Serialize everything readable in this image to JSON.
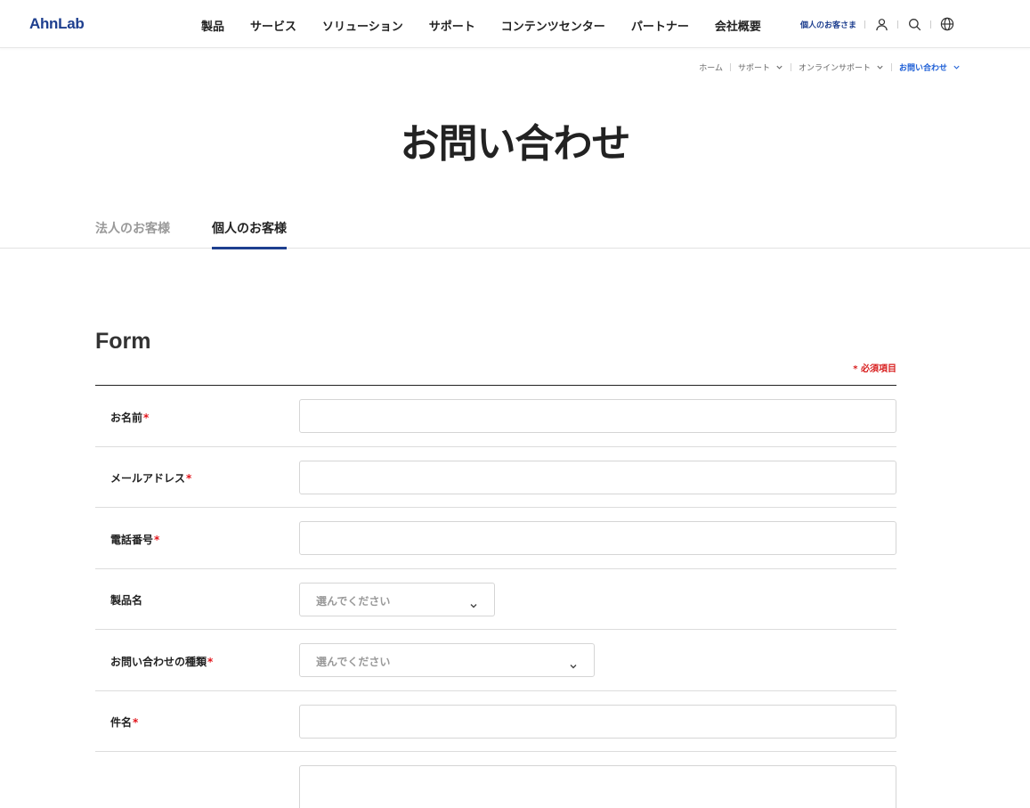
{
  "header": {
    "logo": "AhnLab",
    "nav": [
      "製品",
      "サービス",
      "ソリューション",
      "サポート",
      "コンテンツセンター",
      "パートナー",
      "会社概要"
    ],
    "util_link": "個人のお客さま",
    "icons": [
      "user-icon",
      "search-icon",
      "globe-icon"
    ]
  },
  "breadcrumb": {
    "items": [
      "ホーム",
      "サポート",
      "オンラインサポート",
      "お問い合わせ"
    ]
  },
  "page": {
    "title": "お問い合わせ"
  },
  "tabs": {
    "items": [
      "法人のお客様",
      "個人のお客様"
    ],
    "active": "個人のお客様"
  },
  "form": {
    "title": "Form",
    "required_note": "* 必須項目",
    "required_mark": "*",
    "fields": {
      "name": {
        "label": "お名前",
        "value": ""
      },
      "email": {
        "label": "メールアドレス",
        "value": ""
      },
      "phone": {
        "label": "電話番号",
        "value": ""
      },
      "product": {
        "label": "製品名",
        "selected": "選んでください"
      },
      "inquiry_type": {
        "label": "お問い合わせの種類",
        "selected": "選んでください"
      },
      "subject": {
        "label": "件名",
        "value": ""
      },
      "content": {
        "value": ""
      }
    }
  },
  "colors": {
    "brand": "#1e3f8f",
    "link_active": "#1e5fd6",
    "required": "#e2141b"
  }
}
